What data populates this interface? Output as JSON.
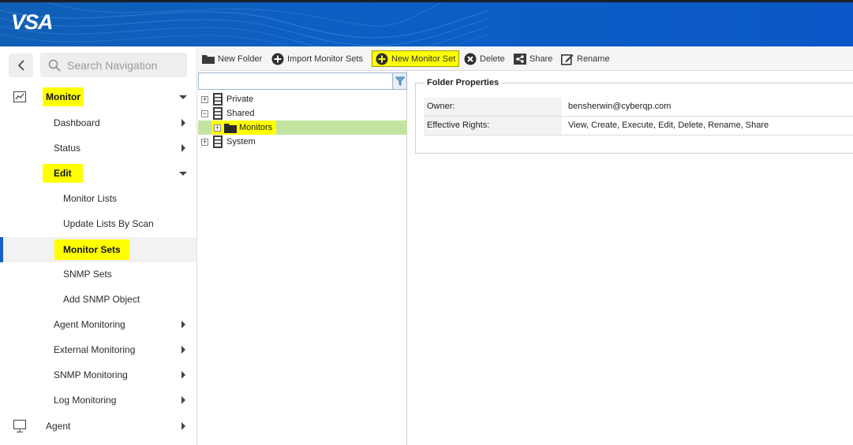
{
  "app": {
    "logo_text": "VSA"
  },
  "sidebar": {
    "search": {
      "placeholder": "Search Navigation",
      "value": ""
    },
    "module": {
      "label": "Monitor",
      "icon": "chart-line-icon"
    },
    "items": [
      {
        "label": "Dashboard"
      },
      {
        "label": "Status"
      },
      {
        "label": "Edit"
      },
      {
        "label": "Monitor Lists"
      },
      {
        "label": "Update Lists By Scan"
      },
      {
        "label": "Monitor Sets"
      },
      {
        "label": "SNMP Sets"
      },
      {
        "label": "Add SNMP Object"
      },
      {
        "label": "Agent Monitoring"
      },
      {
        "label": "External Monitoring"
      },
      {
        "label": "SNMP Monitoring"
      },
      {
        "label": "Log Monitoring"
      }
    ],
    "bottom_module": {
      "label": "Agent",
      "icon": "monitor-icon"
    }
  },
  "toolbar": {
    "new_folder": "New Folder",
    "import_sets": "Import Monitor Sets",
    "new_set": "New Monitor Set",
    "delete": "Delete",
    "share": "Share",
    "rename": "Rename"
  },
  "tree": {
    "filter_value": "",
    "nodes": [
      {
        "label": "Private"
      },
      {
        "label": "Shared"
      },
      {
        "label": "Monitors"
      },
      {
        "label": "System"
      }
    ]
  },
  "folder_properties": {
    "title": "Folder Properties",
    "owner_label": "Owner:",
    "owner_value": "bensherwin@cyberqp.com",
    "rights_label": "Effective Rights:",
    "rights_value": "View, Create, Execute, Edit, Delete, Rename, Share"
  },
  "colors": {
    "header_blue": "#0d5fc4",
    "highlight_yellow": "#ffff00",
    "active_bar": "#1662c4",
    "tree_selection": "#c3e3a0"
  }
}
